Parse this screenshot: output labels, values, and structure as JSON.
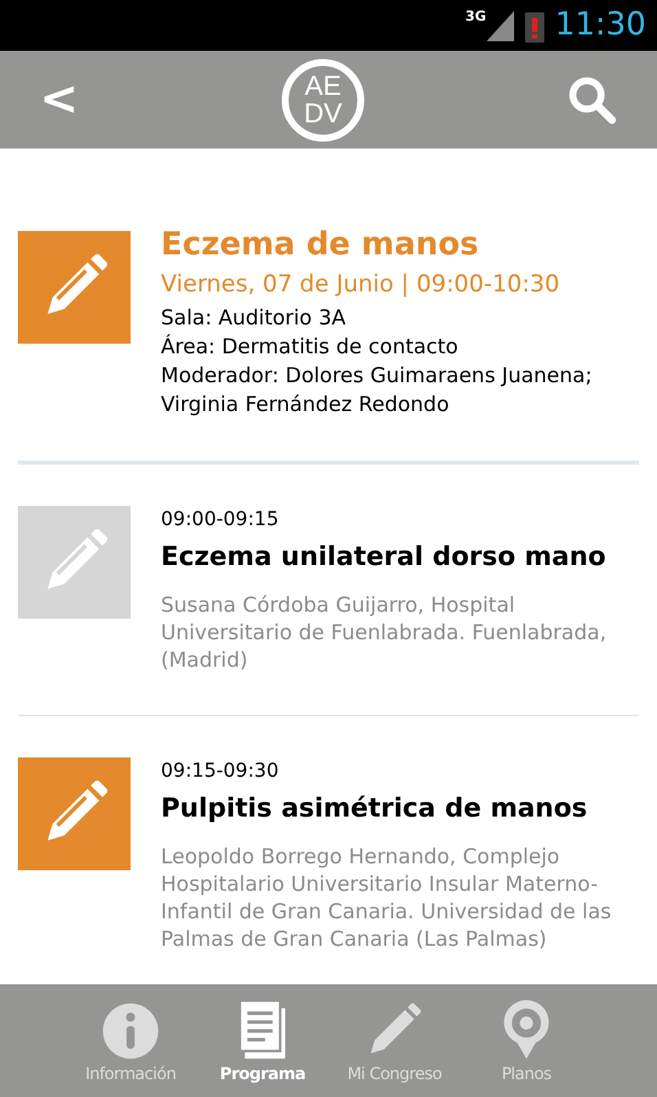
{
  "status_bar": {
    "network": "3G",
    "time": "11:30"
  },
  "header": {
    "back": "<",
    "logo": [
      "AE",
      "DV"
    ]
  },
  "session": {
    "favorite": true,
    "title": "Eczema de manos",
    "date": "Viernes, 07 de Junio | 09:00-10:30",
    "lines": [
      "Sala: Auditorio 3A",
      "Área: Dermatitis de contacto",
      "Moderador: Dolores Guimaraens Juanena; Virginia Fernández Redondo"
    ]
  },
  "talks": [
    {
      "favorite": false,
      "time": "09:00-09:15",
      "title": "Eczema unilateral dorso mano",
      "authors": "Susana Córdoba Guijarro, Hospital Universitario de Fuenlabrada. Fuenlabrada, (Madrid)"
    },
    {
      "favorite": true,
      "time": "09:15-09:30",
      "title": "Pulpitis asimétrica de manos",
      "authors": "Leopoldo Borrego Hernando, Complejo Hospitalario Universitario Insular Materno-Infantil de Gran Canaria. Universidad de las Palmas de Gran Canaria (Las Palmas)"
    }
  ],
  "nav": [
    {
      "kind": "info",
      "label": "Información",
      "selected": false
    },
    {
      "kind": "program",
      "label": "Programa",
      "selected": true
    },
    {
      "kind": "pencil",
      "label": "Mi Congreso",
      "selected": false
    },
    {
      "kind": "pin",
      "label": "Planos",
      "selected": false
    }
  ]
}
